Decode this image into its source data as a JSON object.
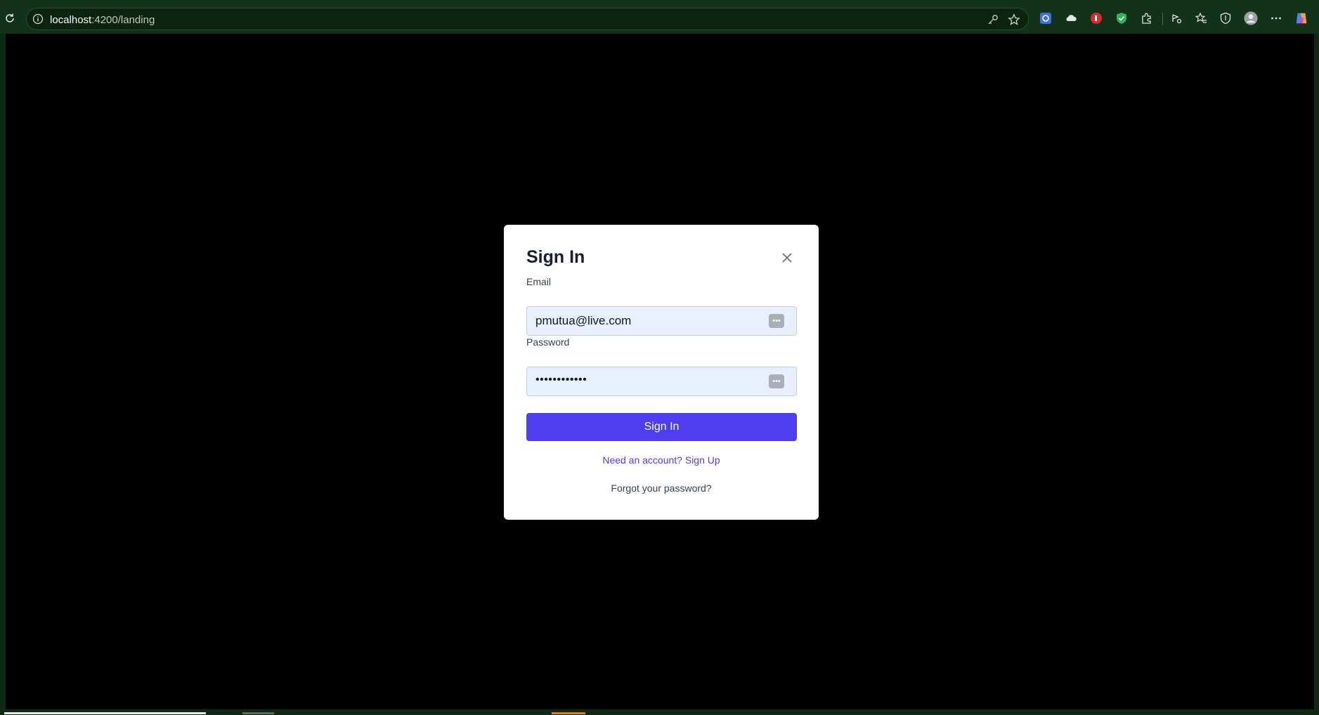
{
  "browser": {
    "url_host": "localhost",
    "url_path": ":4200/landing",
    "accent_color": "#12321a"
  },
  "icons": {
    "reload": "reload-icon",
    "info": "site-info-icon",
    "key": "key-icon",
    "favorite": "favorite-star-icon",
    "extensions": [
      "extension-1-icon",
      "cloud-icon",
      "red-extension-icon",
      "green-shield-icon",
      "puzzle-icon",
      "read-aloud-icon",
      "favorites-icon",
      "browser-essentials-icon",
      "profile-avatar-icon",
      "more-menu-icon",
      "copilot-icon"
    ]
  },
  "modal": {
    "title": "Sign In",
    "email_label": "Email",
    "email_value": "pmutua@live.com",
    "password_label": "Password",
    "password_value": "••••••••••••",
    "submit_label": "Sign In",
    "signup_link": "Need an account? Sign Up",
    "forgot_link": "Forgot your password?",
    "primary_color": "#4f3df0"
  }
}
